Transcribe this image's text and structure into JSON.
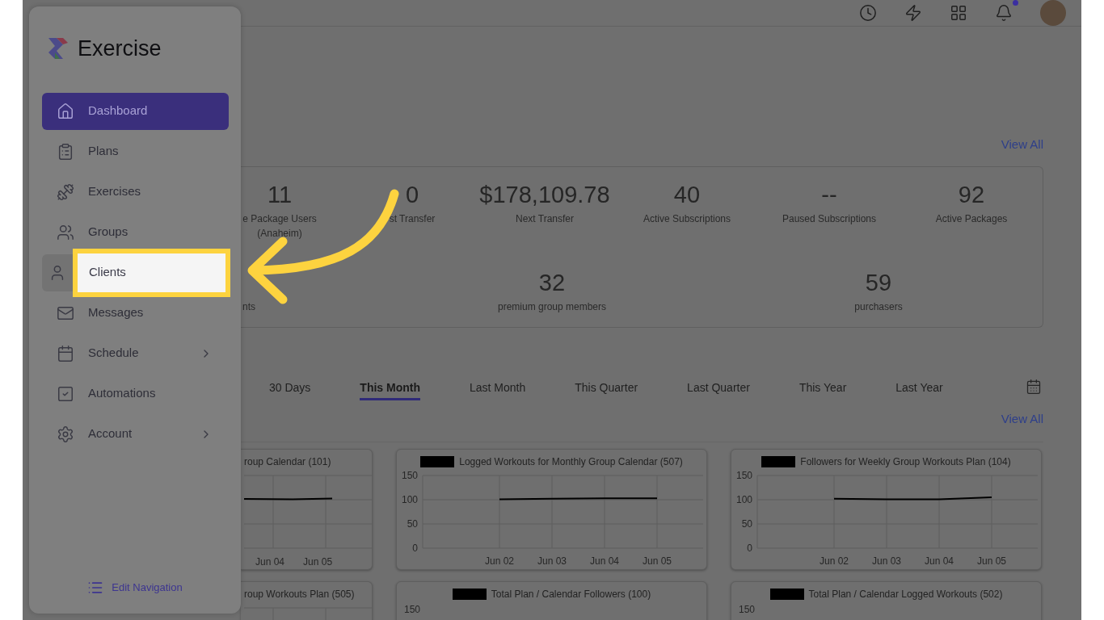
{
  "sidebar": {
    "brand": "Exercise",
    "items": [
      {
        "label": "Dashboard",
        "selected": true,
        "highlighted": false,
        "has_submenu": false
      },
      {
        "label": "Plans",
        "selected": false,
        "highlighted": false,
        "has_submenu": false
      },
      {
        "label": "Exercises",
        "selected": false,
        "highlighted": false,
        "has_submenu": false
      },
      {
        "label": "Groups",
        "selected": false,
        "highlighted": false,
        "has_submenu": false
      },
      {
        "label": "Clients",
        "selected": false,
        "highlighted": true,
        "has_submenu": false
      },
      {
        "label": "Messages",
        "selected": false,
        "highlighted": false,
        "has_submenu": false
      },
      {
        "label": "Schedule",
        "selected": false,
        "highlighted": false,
        "has_submenu": true
      },
      {
        "label": "Automations",
        "selected": false,
        "highlighted": false,
        "has_submenu": false
      },
      {
        "label": "Account",
        "selected": false,
        "highlighted": false,
        "has_submenu": true
      }
    ],
    "footer_link": "Edit Navigation"
  },
  "header": {
    "notifications_unread": true
  },
  "stats": {
    "view_all": "View All",
    "row_1": [
      {
        "value": "11",
        "label": "e Package Users (Anaheim)"
      },
      {
        "value": "0",
        "label": "st Transfer"
      },
      {
        "value": "$178,109.78",
        "label": "Next Transfer"
      },
      {
        "value": "40",
        "label": "Active Subscriptions"
      },
      {
        "value": "--",
        "label": "Paused Subscriptions"
      },
      {
        "value": "92",
        "label": "Active Packages"
      }
    ],
    "row_2": [
      {
        "label": "nts"
      },
      {
        "value": "32",
        "label": "premium group members"
      },
      {
        "value": "59",
        "label": "purchasers"
      }
    ]
  },
  "period_tabs": [
    {
      "label": "30 Days",
      "selected": false
    },
    {
      "label": "This Month",
      "selected": true
    },
    {
      "label": "Last Month",
      "selected": false
    },
    {
      "label": "This Quarter",
      "selected": false
    },
    {
      "label": "Last Quarter",
      "selected": false
    },
    {
      "label": "This Year",
      "selected": false
    },
    {
      "label": "Last Year",
      "selected": false
    }
  ],
  "charts_view_all": "View All",
  "charts": [
    {
      "title": "roup Calendar (101)",
      "redacted": false,
      "x_labels": [
        "Jun 04",
        "Jun 05"
      ]
    },
    {
      "title": "Logged Workouts for Monthly Group Calendar (507)",
      "redacted": true,
      "chart_data": {
        "type": "line",
        "x": [
          "Jun 02",
          "Jun 03",
          "Jun 04",
          "Jun 05"
        ],
        "ylim": [
          0,
          150
        ],
        "yticks": [
          0,
          50,
          100,
          150
        ],
        "grid": true,
        "series": [
          {
            "color": "#000000",
            "values": [
              101,
              102,
              103,
              103
            ]
          }
        ]
      }
    },
    {
      "title": "Followers for Weekly Group Workouts Plan (104)",
      "redacted": true,
      "chart_data": {
        "type": "line",
        "x": [
          "Jun 02",
          "Jun 03",
          "Jun 04",
          "Jun 05"
        ],
        "ylim": [
          0,
          150
        ],
        "yticks": [
          0,
          50,
          100,
          150
        ],
        "grid": true,
        "series": [
          {
            "color": "#000000",
            "values": [
              102,
              101,
              101,
              105
            ]
          }
        ]
      }
    },
    {
      "title": "roup Workouts Plan (505)",
      "redacted": false
    },
    {
      "title": "Total Plan / Calendar Followers (100)",
      "redacted": true,
      "y_labels": [
        "150"
      ]
    },
    {
      "title": "Total Plan / Calendar Logged Workouts (502)",
      "redacted": true,
      "y_labels": [
        "150"
      ]
    }
  ]
}
